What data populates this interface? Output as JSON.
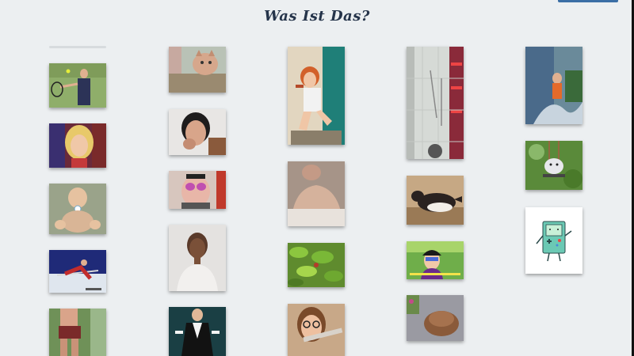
{
  "header": {
    "title": "Was Ist Das?"
  },
  "gallery": {
    "columns": [
      {
        "name": "column-1",
        "tiles": [
          {
            "name": "gif-tennis-player"
          },
          {
            "name": "gif-blonde-woman"
          },
          {
            "name": "gif-baby"
          },
          {
            "name": "gif-gymnast"
          },
          {
            "name": "gif-athlete-legs"
          }
        ]
      },
      {
        "name": "column-2",
        "tiles": [
          {
            "name": "gif-flying-cat"
          },
          {
            "name": "gif-woman-eating"
          },
          {
            "name": "gif-face-paint"
          },
          {
            "name": "gif-smiling-woman"
          },
          {
            "name": "gif-man-in-suit"
          }
        ]
      },
      {
        "name": "column-3",
        "tiles": [
          {
            "name": "gif-redhead-woman"
          },
          {
            "name": "gif-sleeping-man"
          },
          {
            "name": "gif-plant-leaves"
          },
          {
            "name": "gif-girl-with-glasses"
          }
        ]
      },
      {
        "name": "column-4",
        "tiles": [
          {
            "name": "gif-store-aisle"
          },
          {
            "name": "gif-running-dog"
          },
          {
            "name": "gif-cartoon-character"
          },
          {
            "name": "gif-hairy-object"
          }
        ]
      },
      {
        "name": "column-5",
        "tiles": [
          {
            "name": "gif-water-splash"
          },
          {
            "name": "gif-opossum-swing"
          },
          {
            "name": "gif-bmo-robot"
          }
        ]
      }
    ]
  },
  "colors": {
    "background": "#eceff1",
    "title": "#25344a",
    "accent": "#3b6ea5"
  }
}
